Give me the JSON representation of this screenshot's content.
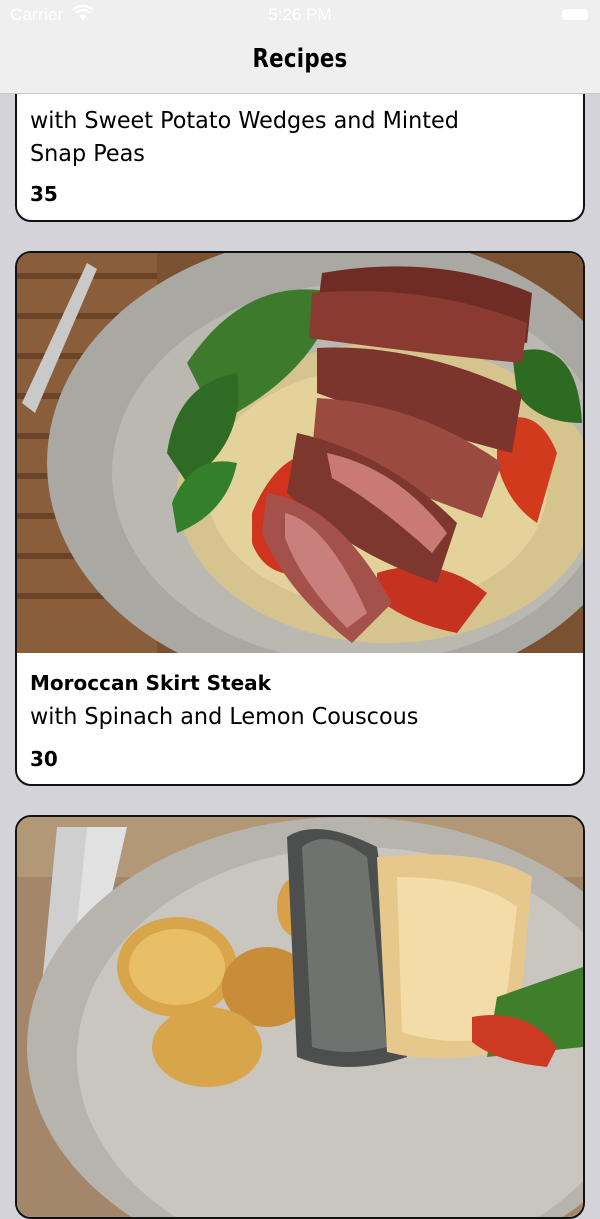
{
  "status_bar": {
    "carrier": "Carrier",
    "time": "5:26 PM",
    "wifi_icon": "wifi-icon",
    "battery_icon": "battery-icon"
  },
  "nav": {
    "title": "Recipes"
  },
  "recipes": [
    {
      "title": "",
      "subtitle": "with Sweet Potato Wedges and Minted Snap Peas",
      "time": "35"
    },
    {
      "title": "Moroccan Skirt Steak",
      "subtitle": "with Spinach and Lemon Couscous",
      "time": "30",
      "image": "steak-couscous-photo"
    },
    {
      "title": "",
      "subtitle": "",
      "time": "",
      "image": "fish-potatoes-photo"
    }
  ],
  "colors": {
    "background": "#d4d3d9",
    "nav_background": "#efefef",
    "card_border": "#111111"
  }
}
